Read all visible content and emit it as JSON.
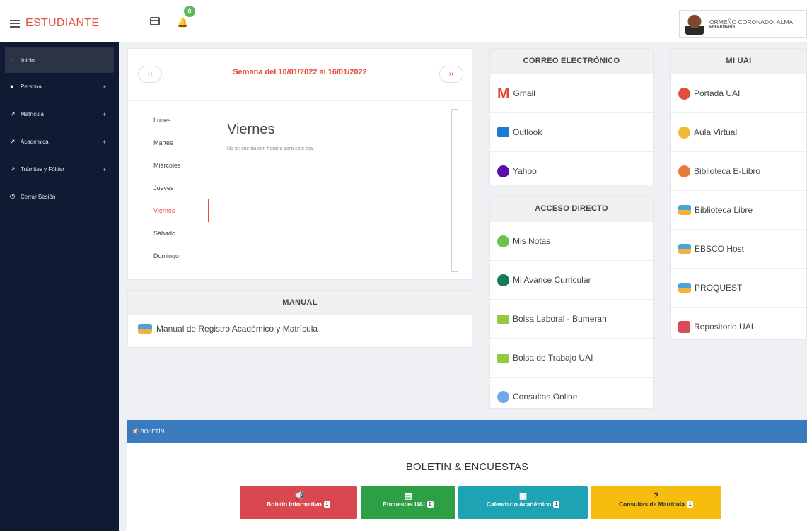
{
  "header": {
    "brand": "ESTUDIANTE",
    "bell_badge": "0",
    "user_name": "ORMEÑO CORONADO, ALMA",
    "user_role": "ENFERMERÍA"
  },
  "sidebar": {
    "items": [
      {
        "label": "Inicio"
      },
      {
        "label": "Personal",
        "plus": "+"
      },
      {
        "label": "Matrícula",
        "plus": "+"
      },
      {
        "label": "Académica",
        "plus": "+"
      },
      {
        "label": "Trámites y Fólder",
        "plus": "+"
      },
      {
        "label": "Cerrar Sesión"
      }
    ]
  },
  "week": {
    "title": "Semana del 10/01/2022 al 16/01/2022",
    "prev": "‹‹",
    "next": "››",
    "days": [
      "Lunes",
      "Martes",
      "Miércoles",
      "Jueves",
      "Viernes",
      "Sábado",
      "Domingo"
    ],
    "selected_day": "Viernes",
    "message": "No se cuenta con horario para este día."
  },
  "manual": {
    "heading": "MANUAL",
    "item": "Manual de Registro Académico y Matrícula"
  },
  "correo": {
    "heading": "CORREO ELECTRÓNICO",
    "items": [
      "Gmail",
      "Outlook",
      "Yahoo"
    ]
  },
  "acceso": {
    "heading": "ACCESO DIRECTO",
    "items": [
      "Mis Notas",
      "Mi Avance Curricular",
      "Bolsa Laboral - Bumeran",
      "Bolsa de Trabajo UAI",
      "Consultas Online"
    ]
  },
  "miuai": {
    "heading": "MI UAI",
    "items": [
      "Portada UAI",
      "Aula Virtual",
      "Biblioteca E-Libro",
      "Biblioteca Libre",
      "EBSCO Host",
      "PROQUEST",
      "Repositorio UAI"
    ]
  },
  "boletin": {
    "bar": "BOLETÍN",
    "title": "BOLETIN & ENCUESTAS",
    "buttons": [
      {
        "label": "Boletín Informativo",
        "badge": "1",
        "color": "#d9474f"
      },
      {
        "label": "Encuestas UAI",
        "badge": "0",
        "color": "#2d9f45"
      },
      {
        "label": "Calendario Académico",
        "badge": "1",
        "color": "#1da3b3"
      },
      {
        "label": "Consultas de Matrícula",
        "badge": "1",
        "color": "#f6bd0f"
      }
    ]
  }
}
